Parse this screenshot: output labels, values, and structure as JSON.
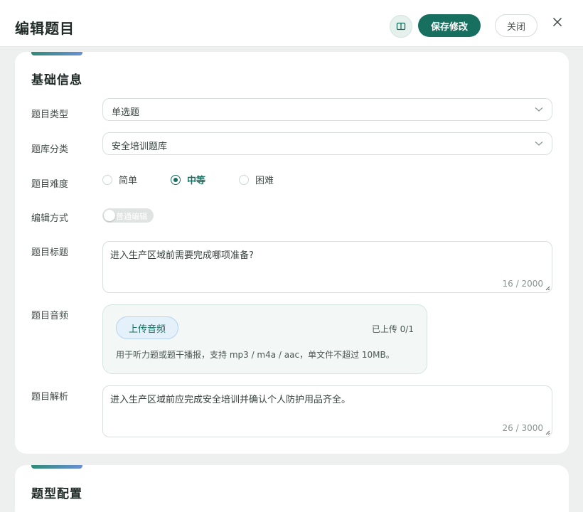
{
  "header": {
    "title": "编辑题目",
    "save_label": "保存修改",
    "close_label": "关闭",
    "book_icon": "book-open-icon",
    "close_icon": "close-icon"
  },
  "basic": {
    "section_title": "基础信息",
    "type_label": "题目类型",
    "type_value": "单选题",
    "bank_label": "题库分类",
    "bank_value": "安全培训题库",
    "difficulty_label": "题目难度",
    "difficulty_options": [
      "简单",
      "中等",
      "困难"
    ],
    "difficulty_selected": "中等",
    "edit_mode_label": "编辑方式",
    "edit_mode_value": "普通编辑",
    "stem_label": "题目标题",
    "stem_value": "进入生产区域前需要完成哪项准备?",
    "stem_count": "16 / 2000",
    "audio_label": "题目音频",
    "audio_upload_label": "上传音频",
    "audio_count": "已上传 0/1",
    "audio_hint": "用于听力题或题干播报，支持 mp3 / m4a / aac，单文件不超过 10MB。",
    "analysis_label": "题目解析",
    "analysis_value": "进入生产区域前应完成安全培训并确认个人防护用品齐全。",
    "analysis_count": "26 / 3000"
  },
  "config": {
    "section_title": "题型配置"
  },
  "colors": {
    "primary": "#17705f",
    "accent_blue": "#6a8fd6"
  }
}
